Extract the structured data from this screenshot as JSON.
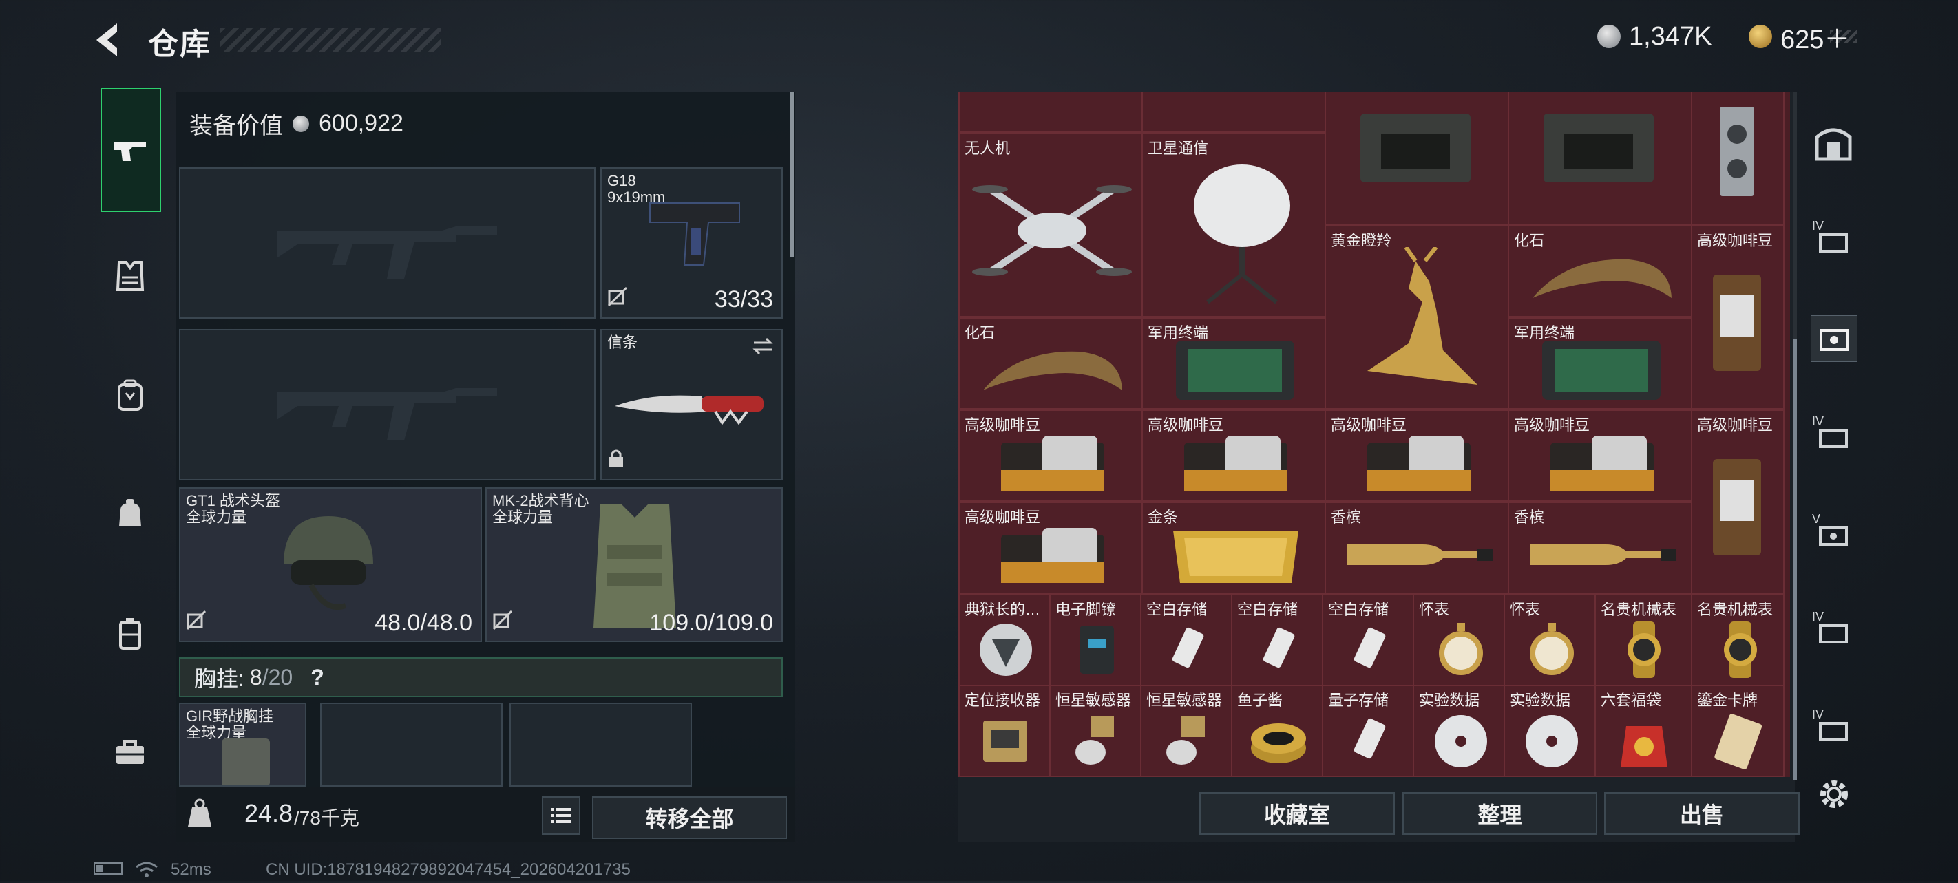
{
  "header": {
    "title": "仓库",
    "currency_silver": "1,347K",
    "currency_gold": "625＋"
  },
  "equip": {
    "value_label": "装备价值",
    "value": "600,922",
    "pistol": {
      "name": "G18",
      "caliber": "9x19mm",
      "ammo": "33/33"
    },
    "melee": {
      "name": "信条"
    },
    "helmet": {
      "name": "GT1 战术头盔",
      "brand": "全球力量",
      "durability": "48.0/48.0"
    },
    "vest": {
      "name": "MK-2战术背心",
      "brand": "全球力量",
      "durability": "109.0/109.0"
    },
    "chest": {
      "label": "胸挂:",
      "current": "8",
      "max": "/20",
      "help": "?"
    },
    "rig": {
      "name": "GIR野战胸挂",
      "brand": "全球力量"
    },
    "weight": "24.8",
    "weight_max": "/78千克",
    "transfer_all": "转移全部"
  },
  "storage": {
    "items": [
      {
        "label": "无人机"
      },
      {
        "label": "卫星通信"
      },
      {
        "label": "黄金瞪羚"
      },
      {
        "label": "化石"
      },
      {
        "label": "高级咖啡豆"
      },
      {
        "label": "化石"
      },
      {
        "label": "军用终端"
      },
      {
        "label": "军用终端"
      },
      {
        "label": "高级咖啡豆"
      },
      {
        "label": "高级咖啡豆"
      },
      {
        "label": "高级咖啡豆"
      },
      {
        "label": "高级咖啡豆"
      },
      {
        "label": "高级咖啡豆"
      },
      {
        "label": "高级咖啡豆"
      },
      {
        "label": "金条"
      },
      {
        "label": "香槟"
      },
      {
        "label": "香槟"
      },
      {
        "label": "典狱长的…"
      },
      {
        "label": "电子脚镣"
      },
      {
        "label": "空白存储"
      },
      {
        "label": "空白存储"
      },
      {
        "label": "空白存储"
      },
      {
        "label": "怀表"
      },
      {
        "label": "怀表"
      },
      {
        "label": "名贵机械表"
      },
      {
        "label": "名贵机械表"
      },
      {
        "label": "定位接收器"
      },
      {
        "label": "恒星敏感器"
      },
      {
        "label": "恒星敏感器"
      },
      {
        "label": "鱼子酱"
      },
      {
        "label": "量子存储"
      },
      {
        "label": "实验数据"
      },
      {
        "label": "实验数据"
      },
      {
        "label": "六套福袋"
      },
      {
        "label": "鎏金卡牌"
      }
    ],
    "buttons": {
      "collection": "收藏室",
      "sort": "整理",
      "sell": "出售"
    },
    "filter_labels": [
      "IV",
      "IV",
      "V",
      "IV",
      "IV"
    ]
  },
  "footer": {
    "ping": "52ms",
    "uid": "CN UID:18781948279892047454_202604201735"
  },
  "colors": {
    "accent_green": "#2ed06e",
    "grid_bg": "#4f1f27",
    "grid_border": "#6a2d35"
  }
}
